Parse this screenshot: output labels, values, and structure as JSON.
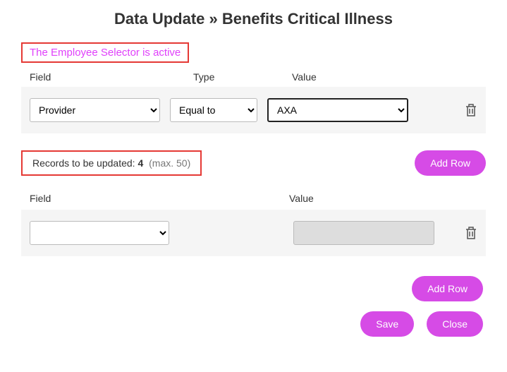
{
  "title": "Data Update » Benefits Critical Illness",
  "selector_notice": "The Employee Selector is active",
  "headers": {
    "field": "Field",
    "type": "Type",
    "value": "Value"
  },
  "filter": {
    "field": "Provider",
    "type": "Equal to",
    "value": "AXA"
  },
  "records": {
    "label": "Records to be updated: ",
    "count": "4",
    "max": "(max. 50)"
  },
  "update_headers": {
    "field": "Field",
    "value": "Value"
  },
  "update": {
    "field": "",
    "value": ""
  },
  "buttons": {
    "add_row": "Add Row",
    "save": "Save",
    "close": "Close"
  }
}
